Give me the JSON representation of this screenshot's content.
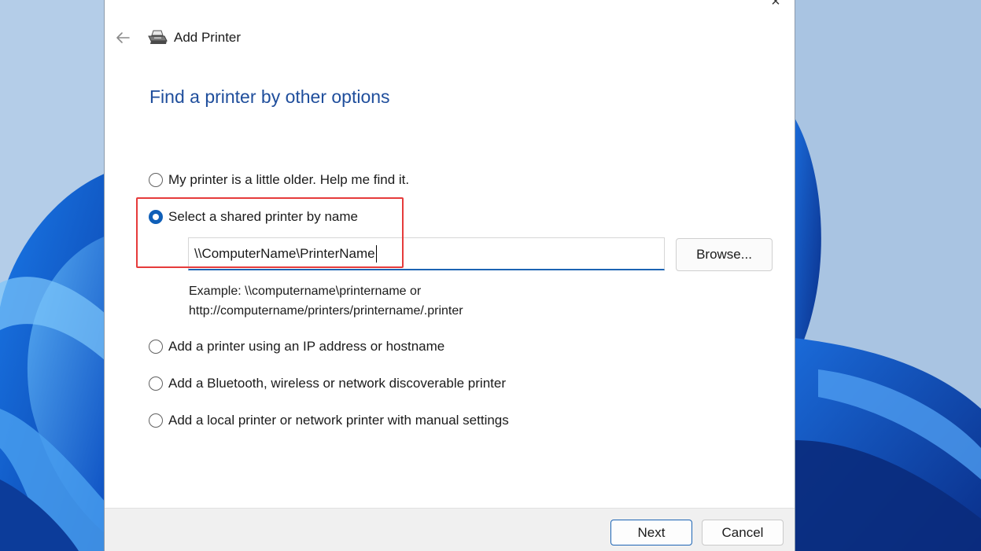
{
  "window": {
    "title": "Add Printer",
    "close_glyph": "×"
  },
  "icons": {
    "back": "back-arrow-icon",
    "printer": "printer-icon",
    "close": "close-icon"
  },
  "main": {
    "heading": "Find a printer by other options",
    "options": [
      {
        "label": "My printer is a little older. Help me find it.",
        "checked": false
      },
      {
        "label": "Select a shared printer by name",
        "checked": true
      },
      {
        "label": "Add a printer using an IP address or hostname",
        "checked": false
      },
      {
        "label": "Add a Bluetooth, wireless or network discoverable printer",
        "checked": false
      },
      {
        "label": "Add a local printer or network printer with manual settings",
        "checked": false
      }
    ],
    "shared_name_value": "\\\\ComputerName\\PrinterName",
    "browse_label": "Browse...",
    "example_line1": "Example: \\\\computername\\printername or",
    "example_line2": "http://computername/printers/printername/.printer"
  },
  "footer": {
    "next_label": "Next",
    "cancel_label": "Cancel"
  },
  "colors": {
    "accent": "#1c64b4",
    "heading": "#1f4e9c",
    "highlight": "#e63b3b",
    "footer_bg": "#f0f0f0"
  }
}
